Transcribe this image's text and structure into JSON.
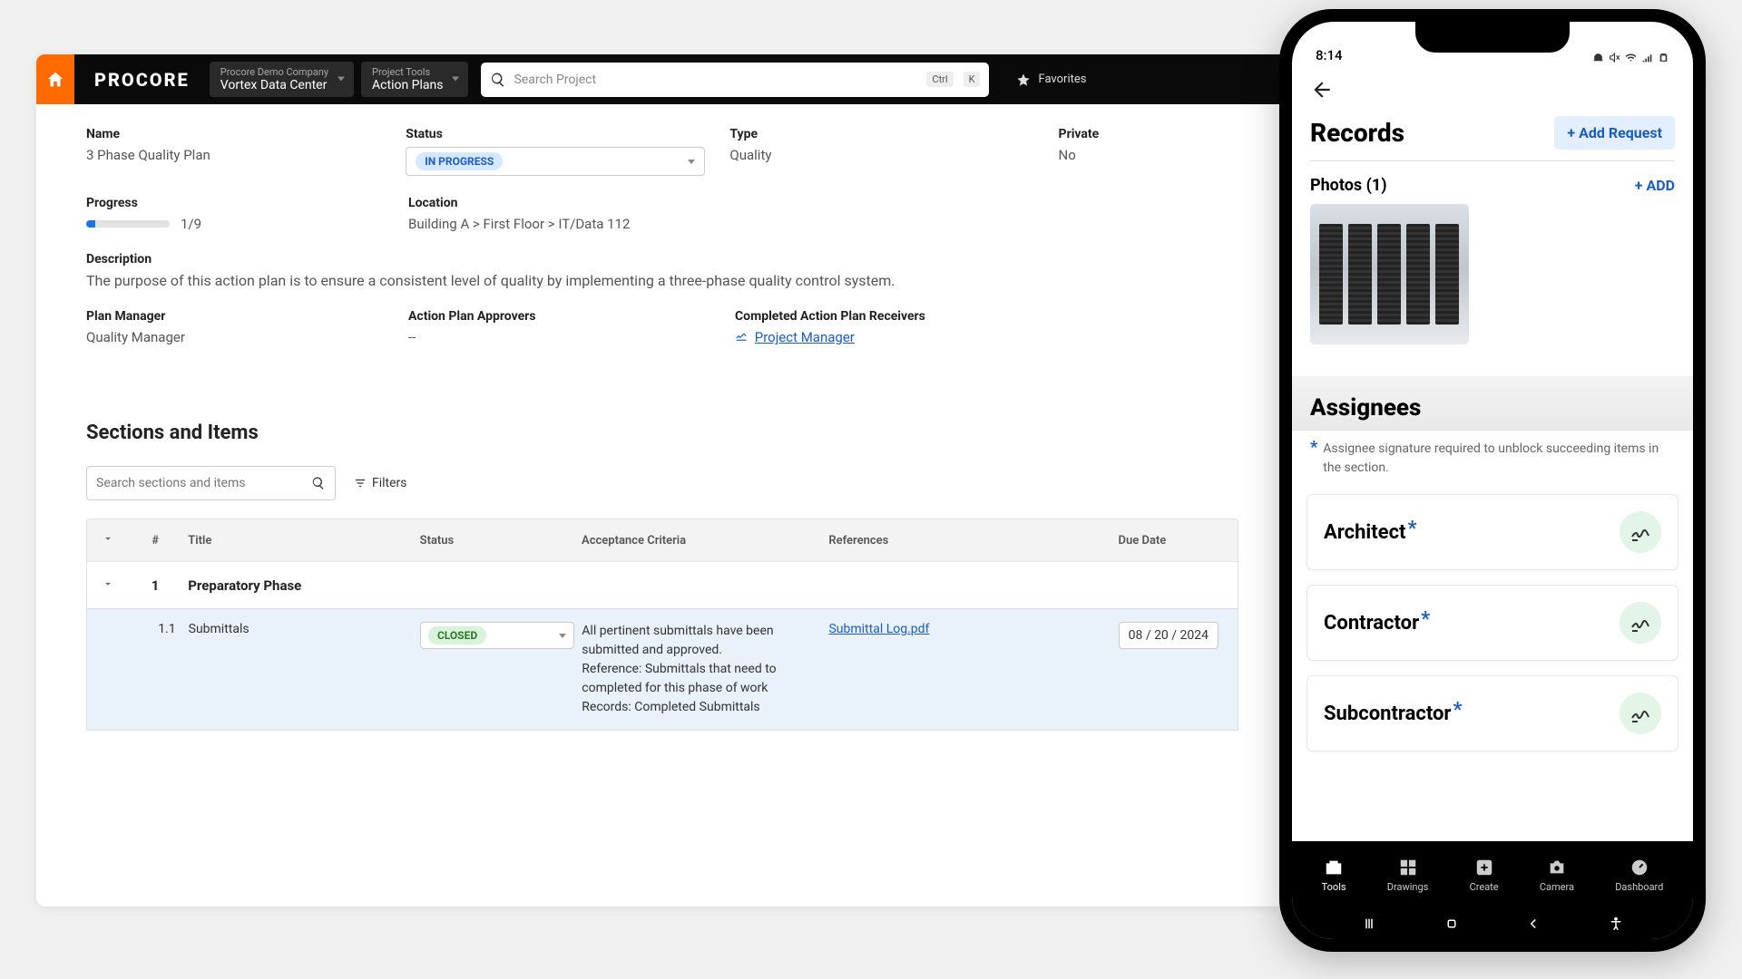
{
  "header": {
    "logo": "PROCORE",
    "company_label": "Procore Demo Company",
    "company_value": "Vortex Data Center",
    "tools_label": "Project Tools",
    "tools_value": "Action Plans",
    "search_placeholder": "Search Project",
    "kbd_ctrl": "Ctrl",
    "kbd_k": "K",
    "favorites": "Favorites"
  },
  "plan": {
    "name_label": "Name",
    "name_value": "3 Phase Quality Plan",
    "status_label": "Status",
    "status_value": "IN PROGRESS",
    "type_label": "Type",
    "type_value": "Quality",
    "private_label": "Private",
    "private_value": "No",
    "progress_label": "Progress",
    "progress_value": "1/9",
    "location_label": "Location",
    "location_value": "Building A > First Floor > IT/Data 112",
    "description_label": "Description",
    "description_value": "The purpose of this action plan is to ensure a consistent level of quality by implementing a three-phase quality control system.",
    "manager_label": "Plan Manager",
    "manager_value": "Quality Manager",
    "approvers_label": "Action Plan Approvers",
    "approvers_value": "--",
    "receivers_label": "Completed Action Plan Receivers",
    "receivers_value": "Project Manager"
  },
  "sections": {
    "title": "Sections and Items",
    "search_placeholder": "Search sections and items",
    "filters": "Filters",
    "columns": {
      "num": "#",
      "title": "Title",
      "status": "Status",
      "criteria": "Acceptance Criteria",
      "references": "References",
      "due": "Due Date"
    },
    "section1": {
      "num": "1",
      "title": "Preparatory Phase"
    },
    "item1": {
      "num": "1.1",
      "title": "Submittals",
      "status": "CLOSED",
      "criteria_l1": "All pertinent submittals have been submitted and approved.",
      "criteria_l2": "Reference: Submittals that need to completed for this phase of work",
      "criteria_l3": "Records: Completed Submittals",
      "reference": "Submittal Log.pdf",
      "due": "08 / 20 / 2024"
    }
  },
  "mobile": {
    "time": "8:14",
    "records_title": "Records",
    "add_request": "+ Add Request",
    "photos_label": "Photos (1)",
    "add": "+ ADD",
    "assignees_title": "Assignees",
    "assignees_note": "Assignee signature required to unblock succeeding items in the section.",
    "assignees": {
      "a1": "Architect",
      "a2": "Contractor",
      "a3": "Subcontractor"
    },
    "tabs": {
      "t1": "Tools",
      "t2": "Drawings",
      "t3": "Create",
      "t4": "Camera",
      "t5": "Dashboard"
    }
  }
}
